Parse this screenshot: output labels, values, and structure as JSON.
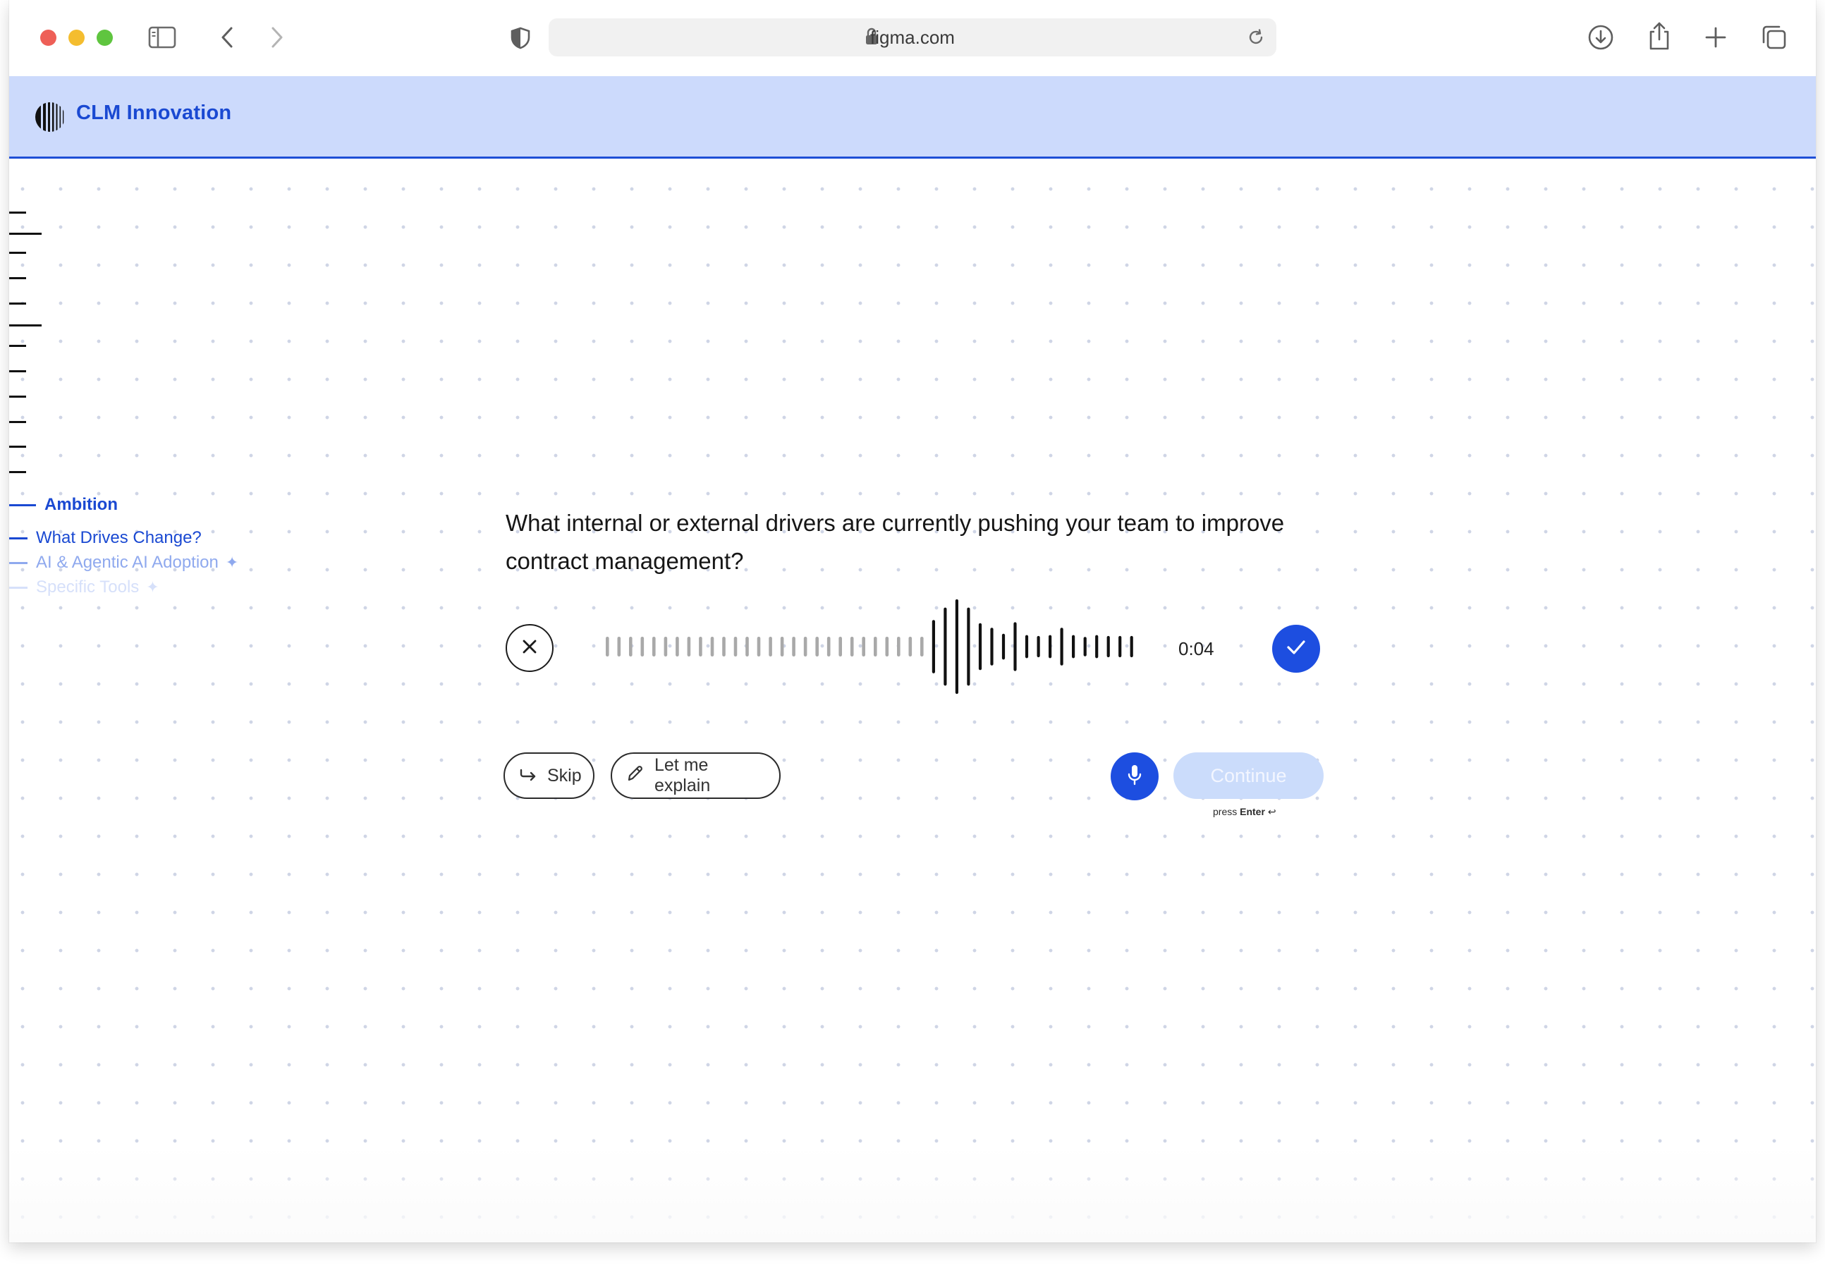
{
  "browser": {
    "url": "figma.com",
    "icons": {
      "sidebar": "sidebar-toggle-icon",
      "back": "chevron-left-icon",
      "forward": "chevron-right-icon",
      "privacy": "shield-icon",
      "lock": "lock-icon",
      "reload": "reload-icon",
      "download": "download-icon",
      "share": "share-icon",
      "new_tab": "plus-icon",
      "tabs": "tabs-overview-icon"
    }
  },
  "header": {
    "brand": "CLM Innovation",
    "logo_icon": "striped-circle-logo-icon",
    "background": "#ccdafc",
    "accent": "#1a49d2"
  },
  "nav": {
    "sections": [
      {
        "label": "Ambition",
        "state": "current-section",
        "color": "#1a49d2"
      },
      {
        "label": "What Drives Change?",
        "state": "current-step",
        "color": "#1a49d2"
      },
      {
        "label": "AI & Agentic AI Adoption",
        "state": "upcoming",
        "color": "#8fa9ee",
        "sparkle": true
      },
      {
        "label": "Specific Tools",
        "state": "upcoming",
        "color": "#d6e0fa",
        "sparkle": true
      }
    ]
  },
  "question": {
    "text": "What internal or external drivers are currently pushing your team to improve contract management?"
  },
  "recorder": {
    "elapsed": "0:04",
    "cancel_icon": "close-icon",
    "confirm_icon": "checkmark-icon",
    "waveform_levels": [
      0.18,
      0.18,
      0.18,
      0.18,
      0.18,
      0.18,
      0.18,
      0.18,
      0.18,
      0.18,
      0.18,
      0.18,
      0.18,
      0.18,
      0.18,
      0.18,
      0.18,
      0.18,
      0.18,
      0.18,
      0.18,
      0.18,
      0.18,
      0.18,
      0.18,
      0.18,
      0.18,
      0.18,
      0.55,
      0.82,
      1.0,
      0.82,
      0.48,
      0.38,
      0.25,
      0.5,
      0.22,
      0.2,
      0.22,
      0.38,
      0.22,
      0.18,
      0.22,
      0.2,
      0.2,
      0.2
    ]
  },
  "actions": {
    "skip_label": "Skip",
    "explain_label": "Let me explain",
    "continue_label": "Continue",
    "press_prefix": "press",
    "press_key": "Enter",
    "skip_icon": "skip-arrow-icon",
    "explain_icon": "pencil-icon",
    "mic_icon": "microphone-icon",
    "enter_icon": "return-key-icon"
  },
  "colors": {
    "primary": "#1d4ee0",
    "continue_disabled": "#cbdcfb"
  }
}
